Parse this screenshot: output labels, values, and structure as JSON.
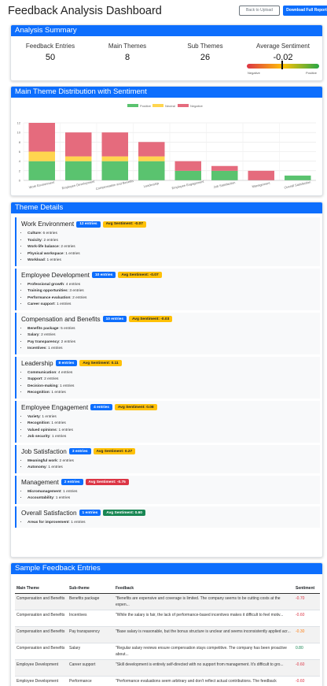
{
  "header": {
    "title": "Feedback Analysis Dashboard",
    "back_label": "Back to Upload",
    "download_label": "Download Full Report"
  },
  "summary": {
    "title": "Analysis Summary",
    "feedback_entries_label": "Feedback Entries",
    "feedback_entries": "50",
    "main_themes_label": "Main Themes",
    "main_themes": "8",
    "sub_themes_label": "Sub Themes",
    "sub_themes": "26",
    "avg_sentiment_label": "Average Sentiment",
    "avg_sentiment": "-0.02",
    "negative_label": "Negative",
    "positive_label": "Positive"
  },
  "chart_card": {
    "title": "Main Theme Distribution with Sentiment"
  },
  "chart_data": {
    "type": "bar",
    "stacked": true,
    "title": "",
    "xlabel": "",
    "ylabel": "",
    "ylim": [
      0,
      12
    ],
    "yticks": [
      0,
      2,
      4,
      6,
      8,
      10,
      12
    ],
    "grid": true,
    "legend_position": "top",
    "categories": [
      "Work Environment",
      "Employee Development",
      "Compensation and Benefits",
      "Leadership",
      "Employee Engagement",
      "Job Satisfaction",
      "Management",
      "Overall Satisfaction"
    ],
    "series": [
      {
        "name": "Positive",
        "color": "#5ac36f",
        "values": [
          4,
          4,
          4,
          4,
          2,
          2,
          0,
          1
        ]
      },
      {
        "name": "Neutral",
        "color": "#ffd54f",
        "values": [
          2,
          1,
          1,
          1,
          0,
          0,
          0,
          0
        ]
      },
      {
        "name": "Negative",
        "color": "#e56b7d",
        "values": [
          6,
          5,
          5,
          3,
          2,
          1,
          2,
          0
        ]
      }
    ]
  },
  "themes_card": {
    "title": "Theme Details",
    "themes": [
      {
        "name": "Work Environment",
        "count": "12 entries",
        "sentiment": "Avg Sentiment: -0.07",
        "level": "warn",
        "subs": [
          {
            "name": "Culture",
            "count": "6 entries"
          },
          {
            "name": "Toxicity",
            "count": "2 entries"
          },
          {
            "name": "Work-life balance",
            "count": "2 entries"
          },
          {
            "name": "Physical workspace",
            "count": "1 entries"
          },
          {
            "name": "Workload",
            "count": "1 entries"
          }
        ]
      },
      {
        "name": "Employee Development",
        "count": "10 entries",
        "sentiment": "Avg Sentiment: -0.07",
        "level": "warn",
        "subs": [
          {
            "name": "Professional growth",
            "count": "4 entries"
          },
          {
            "name": "Training opportunities",
            "count": "3 entries"
          },
          {
            "name": "Performance evaluation",
            "count": "2 entries"
          },
          {
            "name": "Career support",
            "count": "1 entries"
          }
        ]
      },
      {
        "name": "Compensation and Benefits",
        "count": "10 entries",
        "sentiment": "Avg Sentiment: -0.03",
        "level": "warn",
        "subs": [
          {
            "name": "Benefits package",
            "count": "5 entries"
          },
          {
            "name": "Salary",
            "count": "2 entries"
          },
          {
            "name": "Pay transparency",
            "count": "2 entries"
          },
          {
            "name": "Incentives",
            "count": "1 entries"
          }
        ]
      },
      {
        "name": "Leadership",
        "count": "8 entries",
        "sentiment": "Avg Sentiment: 0.11",
        "level": "warn",
        "subs": [
          {
            "name": "Communication",
            "count": "4 entries"
          },
          {
            "name": "Support",
            "count": "2 entries"
          },
          {
            "name": "Decision-making",
            "count": "1 entries"
          },
          {
            "name": "Recognition",
            "count": "1 entries"
          }
        ]
      },
      {
        "name": "Employee Engagement",
        "count": "4 entries",
        "sentiment": "Avg Sentiment: 0.08",
        "level": "warn",
        "subs": [
          {
            "name": "Variety",
            "count": "1 entries"
          },
          {
            "name": "Recognition",
            "count": "1 entries"
          },
          {
            "name": "Valued opinions",
            "count": "1 entries"
          },
          {
            "name": "Job security",
            "count": "1 entries"
          }
        ]
      },
      {
        "name": "Job Satisfaction",
        "count": "3 entries",
        "sentiment": "Avg Sentiment: 0.27",
        "level": "warn",
        "subs": [
          {
            "name": "Meaningful work",
            "count": "2 entries"
          },
          {
            "name": "Autonomy",
            "count": "1 entries"
          }
        ]
      },
      {
        "name": "Management",
        "count": "2 entries",
        "sentiment": "Avg Sentiment: -0.75",
        "level": "danger",
        "subs": [
          {
            "name": "Micromanagement",
            "count": "1 entries"
          },
          {
            "name": "Accountability",
            "count": "1 entries"
          }
        ]
      },
      {
        "name": "Overall Satisfaction",
        "count": "1 entries",
        "sentiment": "Avg Sentiment: 0.60",
        "level": "success",
        "subs": [
          {
            "name": "Areas for improvement",
            "count": "1 entries"
          }
        ]
      }
    ]
  },
  "samples_card": {
    "title": "Sample Feedback Entries",
    "headers": [
      "Main Theme",
      "Sub-theme",
      "Feedback",
      "Sentiment"
    ],
    "rows": [
      {
        "main": "Compensation and Benefits",
        "sub": "Benefits package",
        "feedback": "\"Benefits are expensive and coverage is limited. The company seems to be cutting costs at the expen...",
        "sentiment": "-0.70",
        "tone": "neg"
      },
      {
        "main": "Compensation and Benefits",
        "sub": "Incentives",
        "feedback": "\"While the salary is fair, the lack of performance-based incentives makes it difficult to feel motiv...",
        "sentiment": "-0.60",
        "tone": "neg"
      },
      {
        "main": "Compensation and Benefits",
        "sub": "Pay transparency",
        "feedback": "\"Base salary is reasonable, but the bonus structure is unclear and seems inconsistently applied acr...",
        "sentiment": "-0.30",
        "tone": "warn"
      },
      {
        "main": "Compensation and Benefits",
        "sub": "Salary",
        "feedback": "\"Regular salary reviews ensure compensation stays competitive. The company has been proactive about...",
        "sentiment": "0.80",
        "tone": "pos"
      },
      {
        "main": "Employee Development",
        "sub": "Career support",
        "feedback": "\"Skill development is entirely self-directed with no support from management. It's difficult to gro...",
        "sentiment": "-0.60",
        "tone": "neg"
      },
      {
        "main": "Employee Development",
        "sub": "Performance",
        "feedback": "\"Performance evaluations seem arbitrary and don't reflect actual contributions. The feedback",
        "sentiment": "-0.60",
        "tone": "neg"
      }
    ]
  }
}
